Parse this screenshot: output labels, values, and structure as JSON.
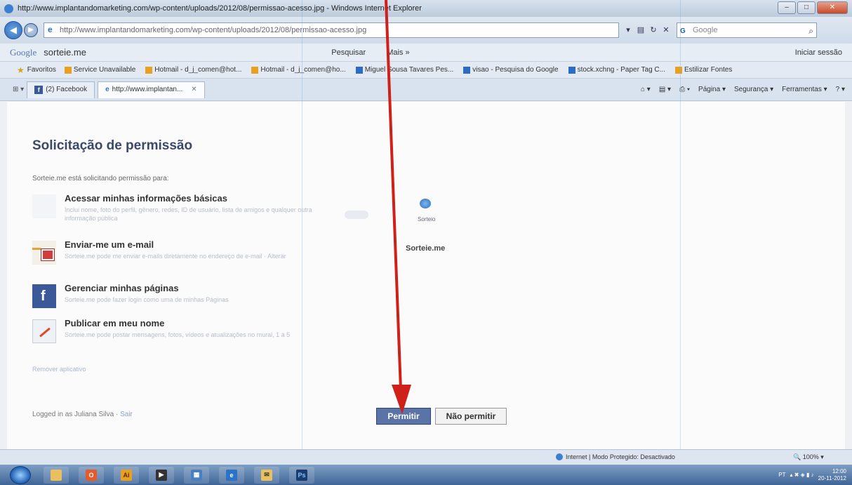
{
  "window": {
    "title": "http://www.implantandomarketing.com/wp-content/uploads/2012/08/permissao-acesso.jpg - Windows Internet Explorer",
    "controls": {
      "minimize": "–",
      "maximize": "□",
      "close": "✕"
    }
  },
  "address_bar": {
    "url": "http://www.implantandomarketing.com/wp-content/uploads/2012/08/permissao-acesso.jpg",
    "search_placeholder": "Google"
  },
  "google_toolbar": {
    "logo": "Google",
    "query": "sorteie.me",
    "search_label": "Pesquisar",
    "more_label": "Mais »",
    "signin_label": "Iniciar sessão"
  },
  "favorites_bar": {
    "label": "Favoritos",
    "items": [
      {
        "label": "Service Unavailable",
        "icon": "orange"
      },
      {
        "label": "Hotmail - d_j_comen@hot...",
        "icon": "orange"
      },
      {
        "label": "Hotmail - d_j_comen@ho...",
        "icon": "orange"
      },
      {
        "label": "Miguel Sousa Tavares Pes...",
        "icon": "blue"
      },
      {
        "label": "visao - Pesquisa do Google",
        "icon": "blue"
      },
      {
        "label": "stock.xchng - Paper Tag C...",
        "icon": "blue"
      },
      {
        "label": "Estilizar Fontes",
        "icon": "orange"
      }
    ]
  },
  "tabs": [
    {
      "label": "(2) Facebook",
      "active": false
    },
    {
      "label": "http://www.implantan...",
      "active": true
    }
  ],
  "command_bar": {
    "page": "Página ▾",
    "security": "Segurança ▾",
    "tools": "Ferramentas ▾"
  },
  "dialog": {
    "title": "Solicitação de permissão",
    "intro": "Sorteie.me está solicitando permissão para:",
    "permissions": [
      {
        "title": "Acessar minhas informações básicas",
        "description": "Inclui nome, foto do perfil, gênero, redes, ID de usuário, lista de amigos e qualquer outra informação pública",
        "icon": "basic"
      },
      {
        "title": "Enviar-me um e-mail",
        "description": "Sorteie.me pode me enviar e-mails diretamente no endereço de e-mail · Alterar",
        "icon": "email"
      },
      {
        "title": "Gerenciar minhas páginas",
        "description": "Sorteie.me pode fazer login como uma de minhas Páginas",
        "icon": "pages"
      },
      {
        "title": "Publicar em meu nome",
        "description": "Sorteie.me pode postar mensagens, fotos, vídeos e atualizações no mural, 1 a 5",
        "icon": "publish"
      }
    ],
    "remove_link": "Remover aplicativo",
    "app_small_label": "Sorteio",
    "app_name": "Sorteie.me",
    "logged_in": "Logged in as Juliana Silva ·",
    "logout": "Sair",
    "allow_button": "Permitir",
    "deny_button": "Não permitir"
  },
  "status_bar": {
    "zone": "Internet | Modo Protegido: Desactivado",
    "zoom": "100%"
  },
  "taskbar": {
    "apps": [
      {
        "name": "explorer",
        "label": "",
        "color": "#e8c060"
      },
      {
        "name": "media",
        "label": "O",
        "color": "#e55a2a"
      },
      {
        "name": "illustrator",
        "label": "Ai",
        "color": "#e8a020"
      },
      {
        "name": "player",
        "label": "▶",
        "color": "#333333"
      },
      {
        "name": "calculator",
        "label": "▦",
        "color": "#4a7fc0"
      },
      {
        "name": "ie",
        "label": "e",
        "color": "#2c73c8"
      },
      {
        "name": "mail",
        "label": "✉",
        "color": "#e8c060"
      },
      {
        "name": "photoshop",
        "label": "Ps",
        "color": "#1a3c6e"
      }
    ],
    "language": "PT",
    "time": "12:00",
    "date": "20-11-2012"
  },
  "colors": {
    "facebook_blue": "#3b5998",
    "allow_button": "#5b74a8",
    "arrow": "#d0201a"
  }
}
